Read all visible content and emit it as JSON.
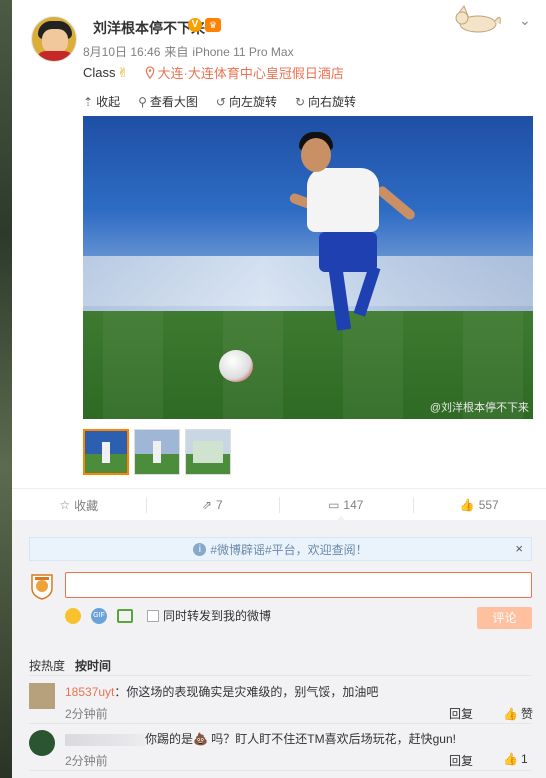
{
  "post": {
    "username": "刘洋根本停不下来",
    "date": "8月10日 16:46",
    "source_prefix": "来自",
    "source_device": "iPhone 11 Pro Max",
    "text": "Class",
    "location": "大连·大连体育中心皇冠假日酒店",
    "watermark": "@刘洋根本停不下来"
  },
  "image_tools": {
    "collapse": "收起",
    "view_large": "查看大图",
    "rotate_left": "向左旋转",
    "rotate_right": "向右旋转"
  },
  "actions": {
    "favorite": "收藏",
    "repost_count": "7",
    "comment_count": "147",
    "like_count": "557"
  },
  "comment_box": {
    "notice_tag": "#微博辟谣#",
    "notice_text": "平台，欢迎查阅！",
    "input_value": "",
    "repost_checkbox_label": "同时转发到我的微博",
    "submit_label": "评论"
  },
  "sort": {
    "by_hot": "按热度",
    "by_time": "按时间"
  },
  "comments": [
    {
      "user": "18537uyt",
      "text": "：你这场的表现确实是灾难级的，别气馁，加油吧",
      "time": "2分钟前",
      "reply": "回复",
      "like": "赞"
    },
    {
      "user": "",
      "text": "你踢的是💩 吗？盯人盯不住还TM喜欢后场玩花，赶快gun!",
      "time": "2分钟前",
      "reply": "回复",
      "like": "1"
    }
  ],
  "colors": {
    "accent": "#eb7350",
    "orange": "#ff8200",
    "submit_disabled": "#ffc09f",
    "notice_bg": "#eaf3fb"
  },
  "icons": [
    "chevron-down-icon",
    "location-pin-icon",
    "collapse-icon",
    "magnifier-icon",
    "rotate-left-icon",
    "rotate-right-icon",
    "star-icon",
    "repost-icon",
    "comment-icon",
    "thumbs-up-icon",
    "info-icon",
    "close-icon",
    "emoji-icon",
    "gif-icon",
    "image-icon"
  ]
}
